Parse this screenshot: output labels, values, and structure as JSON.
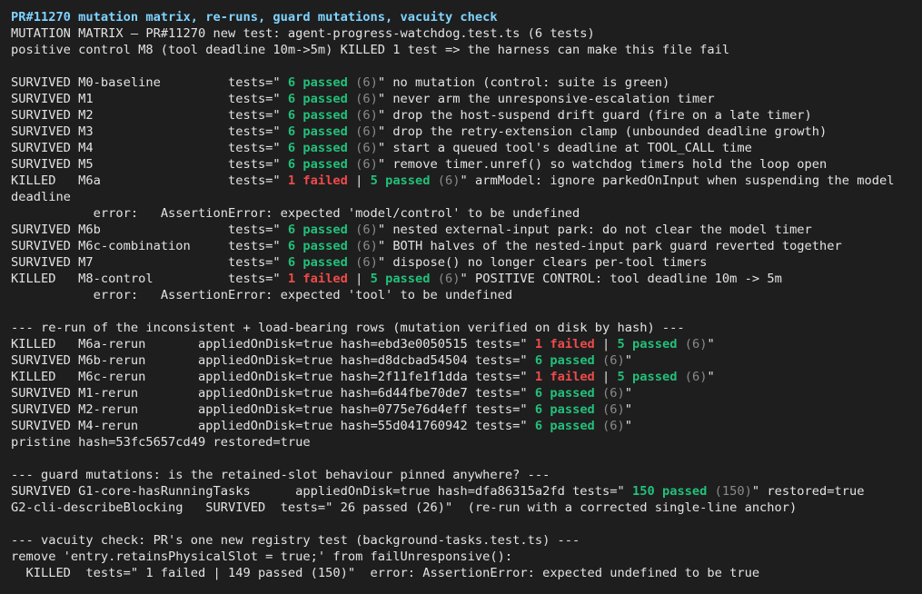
{
  "terminal": {
    "title": "PR#11270 mutation matrix, re-runs, guard mutations, vacuity check",
    "matrix_header": "MUTATION MATRIX — PR#11270 new test: agent-progress-watchdog.test.ts (6 tests)",
    "positive_control": "positive control M8 (tool deadline 10m->5m) KILLED 1 test => the harness can make this file fail",
    "matrix_rows": [
      {
        "status": "SURVIVED",
        "id": "M0-baseline",
        "failed": "",
        "passed": "6 passed",
        "total": "(6)",
        "desc": "no mutation (control: suite is green)"
      },
      {
        "status": "SURVIVED",
        "id": "M1",
        "failed": "",
        "passed": "6 passed",
        "total": "(6)",
        "desc": "never arm the unresponsive-escalation timer"
      },
      {
        "status": "SURVIVED",
        "id": "M2",
        "failed": "",
        "passed": "6 passed",
        "total": "(6)",
        "desc": "drop the host-suspend drift guard (fire on a late timer)"
      },
      {
        "status": "SURVIVED",
        "id": "M3",
        "failed": "",
        "passed": "6 passed",
        "total": "(6)",
        "desc": "drop the retry-extension clamp (unbounded deadline growth)"
      },
      {
        "status": "SURVIVED",
        "id": "M4",
        "failed": "",
        "passed": "6 passed",
        "total": "(6)",
        "desc": "start a queued tool's deadline at TOOL_CALL time"
      },
      {
        "status": "SURVIVED",
        "id": "M5",
        "failed": "",
        "passed": "6 passed",
        "total": "(6)",
        "desc": "remove timer.unref() so watchdog timers hold the loop open"
      },
      {
        "status": "KILLED",
        "id": "M6a",
        "failed": "1 failed",
        "passed": "5 passed",
        "total": "(6)",
        "desc": "armModel: ignore parkedOnInput when suspending the model",
        "wrap": "deadline",
        "error": "AssertionError: expected 'model/control' to be undefined"
      },
      {
        "status": "SURVIVED",
        "id": "M6b",
        "failed": "",
        "passed": "6 passed",
        "total": "(6)",
        "desc": "nested external-input park: do not clear the model timer"
      },
      {
        "status": "SURVIVED",
        "id": "M6c-combination",
        "failed": "",
        "passed": "6 passed",
        "total": "(6)",
        "desc": "BOTH halves of the nested-input park guard reverted together"
      },
      {
        "status": "SURVIVED",
        "id": "M7",
        "failed": "",
        "passed": "6 passed",
        "total": "(6)",
        "desc": "dispose() no longer clears per-tool timers"
      },
      {
        "status": "KILLED",
        "id": "M8-control",
        "failed": "1 failed",
        "passed": "5 passed",
        "total": "(6)",
        "desc": "POSITIVE CONTROL: tool deadline 10m -> 5m",
        "error": "AssertionError: expected 'tool' to be undefined"
      }
    ],
    "error_label": "error:",
    "tests_label": "tests=\"",
    "rerun_header": "--- re-run of the inconsistent + load-bearing rows (mutation verified on disk by hash) ---",
    "rerun_rows": [
      {
        "status": "KILLED",
        "id": "M6a-rerun",
        "applied": "appliedOnDisk=true hash=ebd3e0050515",
        "failed": "1 failed",
        "passed": "5 passed",
        "total": "(6)"
      },
      {
        "status": "SURVIVED",
        "id": "M6b-rerun",
        "applied": "appliedOnDisk=true hash=d8dcbad54504",
        "failed": "",
        "passed": "6 passed",
        "total": "(6)"
      },
      {
        "status": "KILLED",
        "id": "M6c-rerun",
        "applied": "appliedOnDisk=true hash=2f11fe1f1dda",
        "failed": "1 failed",
        "passed": "5 passed",
        "total": "(6)"
      },
      {
        "status": "SURVIVED",
        "id": "M1-rerun",
        "applied": "appliedOnDisk=true hash=6d44fbe70de7",
        "failed": "",
        "passed": "6 passed",
        "total": "(6)"
      },
      {
        "status": "SURVIVED",
        "id": "M2-rerun",
        "applied": "appliedOnDisk=true hash=0775e76d4eff",
        "failed": "",
        "passed": "6 passed",
        "total": "(6)"
      },
      {
        "status": "SURVIVED",
        "id": "M4-rerun",
        "applied": "appliedOnDisk=true hash=55d041760942",
        "failed": "",
        "passed": "6 passed",
        "total": "(6)"
      }
    ],
    "pristine": "pristine hash=53fc5657cd49 restored=true",
    "guard_header": "--- guard mutations: is the retained-slot behaviour pinned anywhere? ---",
    "guard1": {
      "status": "SURVIVED",
      "id": "G1-core-hasRunningTasks",
      "applied": "appliedOnDisk=true hash=dfa86315a2fd",
      "passed": "150 passed",
      "total": "(150)",
      "suffix": "\" restored=true"
    },
    "guard2": "G2-cli-describeBlocking   SURVIVED  tests=\" 26 passed (26)\"  (re-run with a corrected single-line anchor)",
    "vacuity_header": "--- vacuity check: PR's one new registry test (background-tasks.test.ts) ---",
    "vacuity_remove": "remove 'entry.retainsPhysicalSlot = true;' from failUnresponsive():",
    "vacuity_result": "  KILLED  tests=\" 1 failed | 149 passed (150)\"  error: AssertionError: expected undefined to be true",
    "colors": {
      "background": "#1e1e1e",
      "text": "#e3e3e3",
      "title": "#7fd3ff",
      "passed": "#22c07a",
      "failed": "#ef4a4a",
      "dim": "#8a8a8a"
    }
  }
}
